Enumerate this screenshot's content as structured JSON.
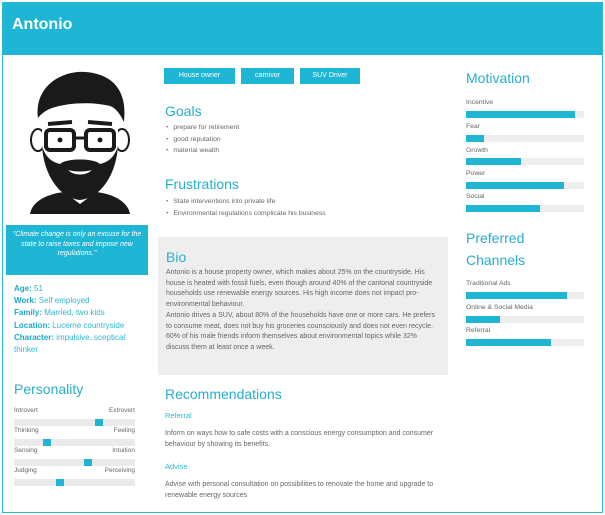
{
  "persona": {
    "name": "Antonio",
    "quote": "\"Climate change is only an excuse for the state to raise taxes and impose new regulations.\"",
    "facts": [
      {
        "key": "Age:",
        "value": "51"
      },
      {
        "key": "Work:",
        "value": "Self employed"
      },
      {
        "key": "Family:",
        "value": "Married, two kids"
      },
      {
        "key": "Location:",
        "value": "Lucerne countryside"
      },
      {
        "key": "Character:",
        "value": "impulsive, sceptical thinker"
      }
    ]
  },
  "tags": [
    "House owner",
    "carnivor",
    "SUV Driver"
  ],
  "goals": {
    "title": "Goals",
    "items": [
      "prepare for retirement",
      "good reputation",
      "material wealth"
    ]
  },
  "frustrations": {
    "title": "Frustrations",
    "items": [
      "State interventions into private life",
      "Environmental regulations complicate his business"
    ]
  },
  "bio": {
    "title": "Bio",
    "paragraphs": [
      "Antonio is a house property owner, which makes about 25% on the countryside. His house is heated with fossil fuels, even though around 40% of the cantonal countryside households use renewable energy sources. His high income does not impact pro-environmental behaviour.",
      "Antonio drives a SUV, about 80% of the households have one or more cars. He prefers to consume meat, does not buy his groceries counsciously and does not even recycle.",
      "60% of his male friends inform themselves about environmental topics while 32% discuss them at least once a week."
    ]
  },
  "recommendations": {
    "title": "Recommendations",
    "sections": [
      {
        "title": "Referral",
        "text": "Inform on ways how to safe costs with a conscious energy consumption and consumer behaviour by showing its benefits."
      },
      {
        "title": "Advise",
        "text": "Advise with personal consultation on possibilities to renovate the home and upgrade to renewable energy sources"
      }
    ]
  },
  "personality": {
    "title": "Personality",
    "traits": [
      {
        "left": "Introvert",
        "right": "Extrovert",
        "level": 0.72
      },
      {
        "left": "Thinking",
        "right": "Feeling",
        "level": 0.26
      },
      {
        "left": "Sensing",
        "right": "Intuition",
        "level": 0.62
      },
      {
        "left": "Judging",
        "right": "Perceiving",
        "level": 0.37
      }
    ]
  },
  "motivation": {
    "title": "Motivation",
    "items": [
      {
        "label": "Incentive",
        "level": 0.92
      },
      {
        "label": "Fear",
        "level": 0.15
      },
      {
        "label": "Growth",
        "level": 0.47
      },
      {
        "label": "Power",
        "level": 0.83
      },
      {
        "label": "Social",
        "level": 0.63
      }
    ]
  },
  "channels": {
    "title_line1": "Preferred",
    "title_line2": "Channels",
    "items": [
      {
        "label": "Traditional Ads",
        "level": 0.86
      },
      {
        "label": "Online & Social Media",
        "level": 0.29
      },
      {
        "label": "Referral",
        "level": 0.72
      }
    ]
  },
  "colors": {
    "accent": "#1fb6d5",
    "heading": "#27aecc",
    "bio_background": "#eeeeee",
    "track": "#eeeeee"
  }
}
